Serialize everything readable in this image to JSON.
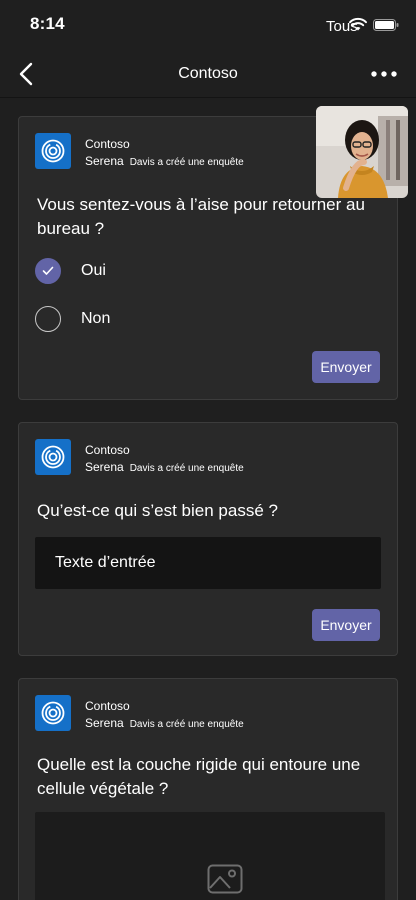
{
  "status": {
    "time": "8:14",
    "network": "Tous"
  },
  "header": {
    "title": "Contoso"
  },
  "cards": [
    {
      "app_name": "Contoso",
      "author": "Serena",
      "action": "Davis a créé une enquête",
      "question": "Vous sentez-vous à l’aise pour retourner au bureau ?",
      "options": [
        {
          "label": "Oui",
          "selected": true
        },
        {
          "label": "Non",
          "selected": false
        }
      ],
      "submit_label": "Envoyer"
    },
    {
      "app_name": "Contoso",
      "author": "Serena",
      "action": "Davis a créé une enquête",
      "question": "Qu’est-ce qui s’est bien passé ?",
      "input_placeholder": "Texte d’entrée",
      "submit_label": "Envoyer"
    },
    {
      "app_name": "Contoso",
      "author": "Serena",
      "action": "Davis a créé une enquête",
      "question": "Quelle est la couche rigide qui entoure une cellule végétale ?"
    }
  ],
  "colors": {
    "accent": "#6264a7",
    "app_icon": "#1570c8",
    "background": "#1f1f1f",
    "card": "#292929"
  },
  "icons": [
    "wifi-icon",
    "battery-icon",
    "back-icon",
    "more-icon",
    "app-icon",
    "checkmark-icon",
    "image-icon"
  ]
}
